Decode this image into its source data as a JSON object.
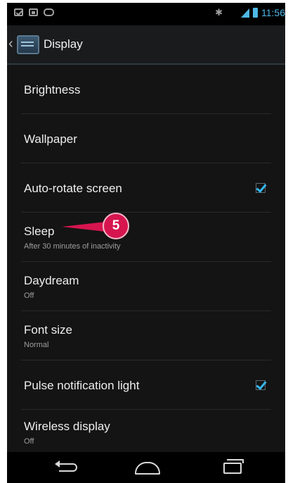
{
  "status_bar": {
    "time": "11:56",
    "left_icons": [
      "mail-icon",
      "image-icon",
      "game-controller-icon"
    ],
    "right_icons": [
      "bluetooth-icon",
      "wifi-icon",
      "signal-icon",
      "battery-icon"
    ]
  },
  "action_bar": {
    "title": "Display",
    "icon": "display-settings-icon"
  },
  "settings": {
    "items": [
      {
        "title": "Brightness",
        "subtitle": "",
        "checked": null
      },
      {
        "title": "Wallpaper",
        "subtitle": "",
        "checked": null
      },
      {
        "title": "Auto-rotate screen",
        "subtitle": "",
        "checked": true
      },
      {
        "title": "Sleep",
        "subtitle": "After 30 minutes of inactivity",
        "checked": null
      },
      {
        "title": "Daydream",
        "subtitle": "Off",
        "checked": null
      },
      {
        "title": "Font size",
        "subtitle": "Normal",
        "checked": null
      },
      {
        "title": "Pulse notification light",
        "subtitle": "",
        "checked": true
      },
      {
        "title": "Wireless display",
        "subtitle": "Off",
        "checked": null
      }
    ]
  },
  "callout": {
    "label": "5",
    "color": "#d6154f"
  },
  "nav_bar": {
    "buttons": [
      "back-icon",
      "home-icon",
      "recent-apps-icon"
    ]
  },
  "colors": {
    "accent": "#35b6f0",
    "background": "#141414"
  }
}
